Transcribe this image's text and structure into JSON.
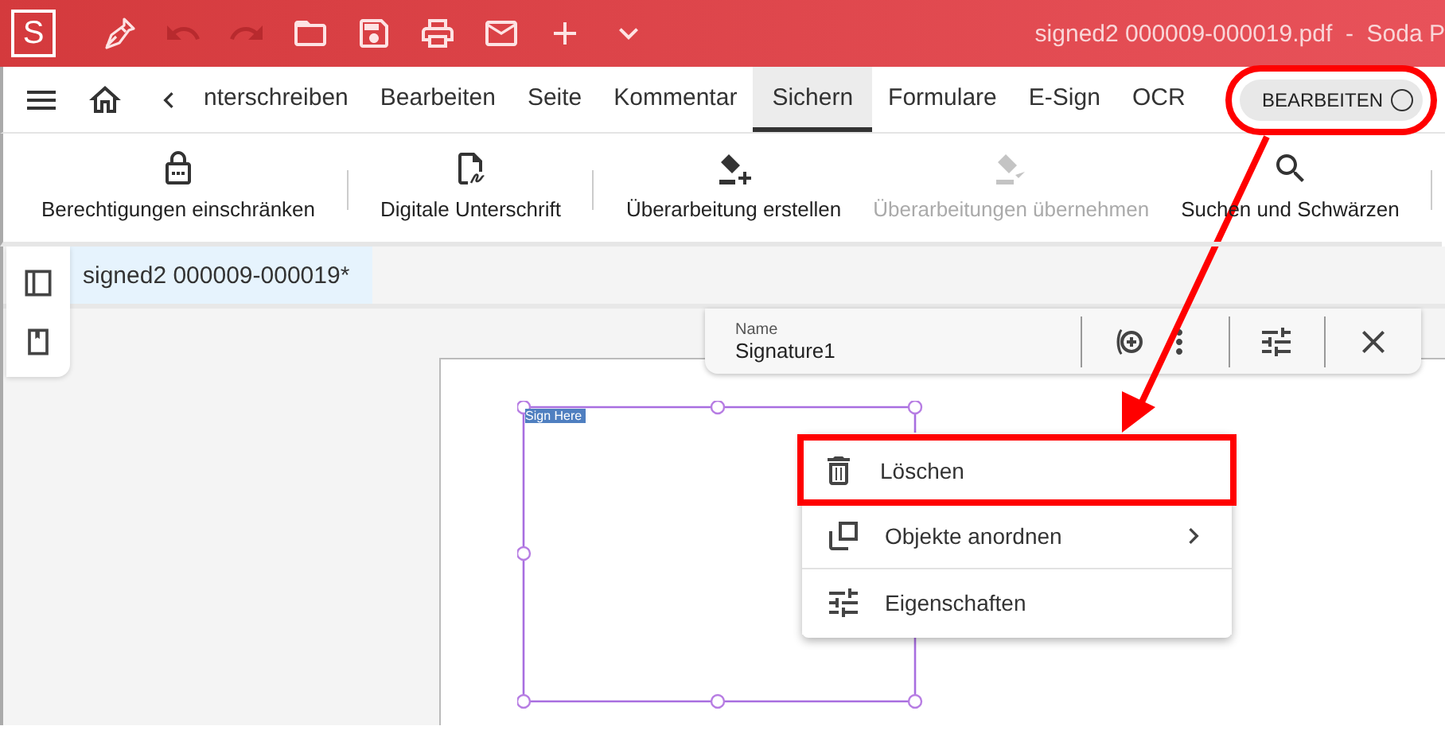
{
  "app": {
    "logo": "S",
    "title": "signed2 000009-000019.pdf  -  Soda P"
  },
  "quick_tools": [
    {
      "kind": "pen",
      "disabled": false
    },
    {
      "kind": "undo",
      "disabled": true
    },
    {
      "kind": "redo",
      "disabled": true
    },
    {
      "kind": "open",
      "disabled": false
    },
    {
      "kind": "save",
      "disabled": false
    },
    {
      "kind": "print",
      "disabled": false
    },
    {
      "kind": "mail",
      "disabled": false
    },
    {
      "kind": "add",
      "disabled": false
    },
    {
      "kind": "more",
      "disabled": false
    }
  ],
  "nav_tabs": [
    {
      "label": "nterschreiben",
      "selected": false
    },
    {
      "label": "Bearbeiten",
      "selected": false
    },
    {
      "label": "Seite",
      "selected": false
    },
    {
      "label": "Kommentar",
      "selected": false
    },
    {
      "label": "Sichern",
      "selected": true
    },
    {
      "label": "Formulare",
      "selected": false
    },
    {
      "label": "E-Sign",
      "selected": false
    },
    {
      "label": "OCR",
      "selected": false
    }
  ],
  "edit_toggle": {
    "label": "BEARBEITEN",
    "on": false,
    "highlighted": true
  },
  "ribbon": [
    {
      "kind": "lock",
      "label": "Berechtigungen einschränken",
      "disabled": false,
      "separator_after": true
    },
    {
      "kind": "signature",
      "label": "Digitale Unterschrift",
      "disabled": false,
      "separator_after": true
    },
    {
      "kind": "redact-add",
      "label": "Überarbeitung erstellen",
      "disabled": false,
      "separator_after": false
    },
    {
      "kind": "redact-apply",
      "label": "Überarbeitungen übernehmen",
      "disabled": true,
      "separator_after": false
    },
    {
      "kind": "search",
      "label": "Suchen und Schwärzen",
      "disabled": false,
      "separator_after": true
    }
  ],
  "document_tab": {
    "label": "signed2 000009-000019*",
    "selected": true
  },
  "field": {
    "label": "Sign Here",
    "selected": true
  },
  "property_bar": {
    "name_label": "Name",
    "name_value": "Signature1"
  },
  "context_menu": [
    {
      "kind": "delete",
      "label": "Löschen",
      "highlighted": true,
      "submenu": false
    },
    {
      "kind": "arrange",
      "label": "Objekte anordnen",
      "highlighted": false,
      "submenu": true
    },
    {
      "kind": "properties",
      "label": "Eigenschaften",
      "highlighted": false,
      "submenu": false
    }
  ]
}
